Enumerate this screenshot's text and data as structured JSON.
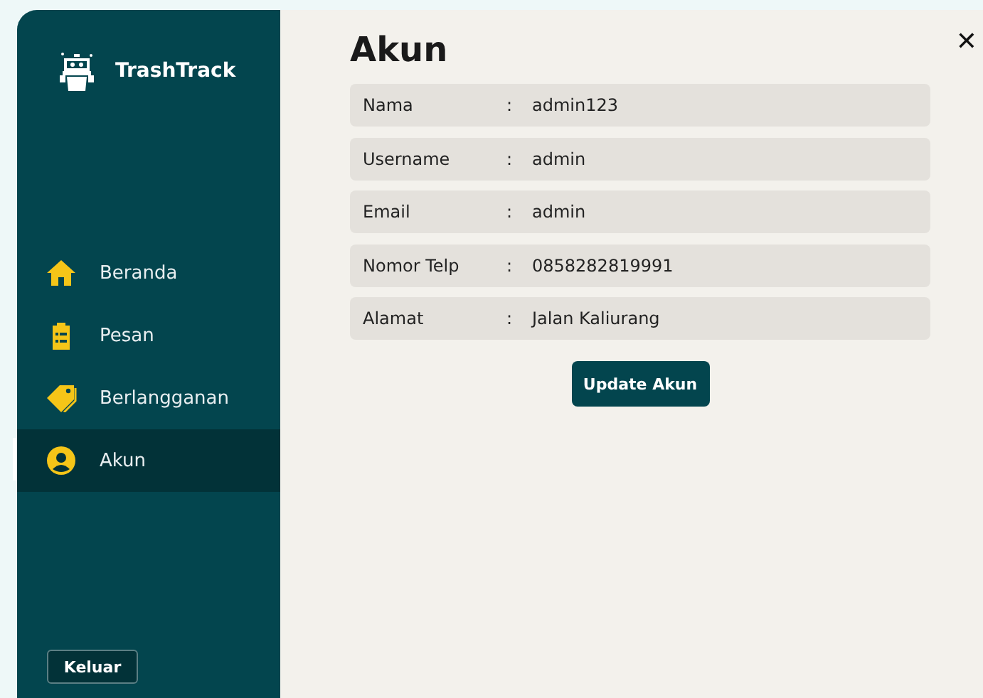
{
  "sidebar": {
    "brand": "TrashTrack",
    "items": [
      {
        "label": "Beranda",
        "selected": false
      },
      {
        "label": "Pesan",
        "selected": false
      },
      {
        "label": "Berlangganan",
        "selected": false
      },
      {
        "label": "Akun",
        "selected": true
      }
    ],
    "logout_button": "Keluar"
  },
  "main": {
    "close": "✕",
    "title": "Akun",
    "fields": [
      {
        "label": "Nama",
        "separator": ":",
        "value": "admin123"
      },
      {
        "label": "Username",
        "separator": ":",
        "value": "admin"
      },
      {
        "label": "Email",
        "separator": ":",
        "value": "admin"
      },
      {
        "label": "Nomor Telp",
        "separator": ":",
        "value": "0858282819991"
      },
      {
        "label": "Alamat",
        "separator": ":",
        "value": "Jalan Kaliurang"
      }
    ],
    "button": "Update Akun"
  }
}
